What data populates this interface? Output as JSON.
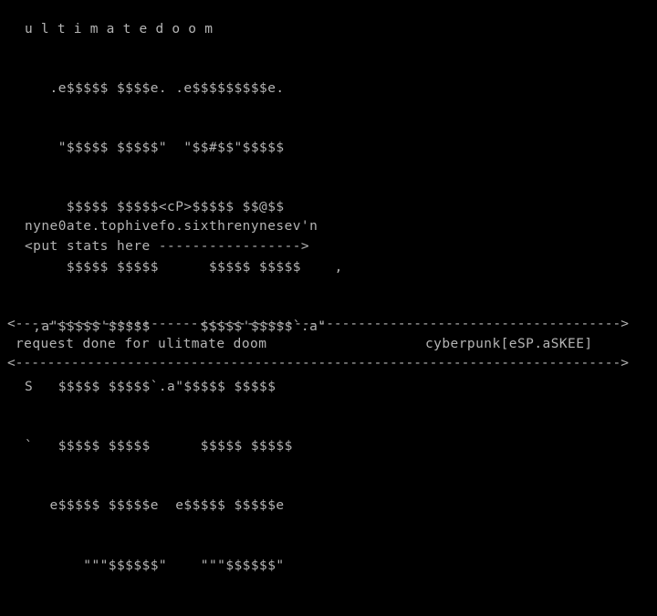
{
  "title": "ultimatedoom",
  "logo_lines": [
    "   .e$$$$$ $$$$e. .e$$$$$$$$$e.",
    "    \"$$$$$ $$$$$\"  \"$$#$$\"$$$$$",
    "     $$$$$ $$$$$<cP>$$$$$ $$@$$",
    "     $$$$$ $$$$$      $$$$$ $$$$$    ,",
    " ,a\"$$$$$'$$$$$      $$$$$'$$$$$`.a\"",
    "S   $$$$$ $$$$$`.a\"$$$$$ $$$$$",
    "`   $$$$$ $$$$$      $$$$$ $$$$$",
    "   e$$$$$ $$$$$e  e$$$$$ $$$$$e",
    "       \"\"\"$$$$$$\"    \"\"\"$$$$$$\""
  ],
  "url_line": "nyne0ate.tophivefo.sixthrenynesev'n",
  "stats_line": "<put stats here ----------------->",
  "status": {
    "left": "request done for ulitmate doom",
    "right": "cyberpunk[eSP.aSKEE]"
  },
  "rule": "<---------------------------------------------------------------------------->",
  "colors": {
    "background": "#000000",
    "text": "#b4b4b4"
  }
}
